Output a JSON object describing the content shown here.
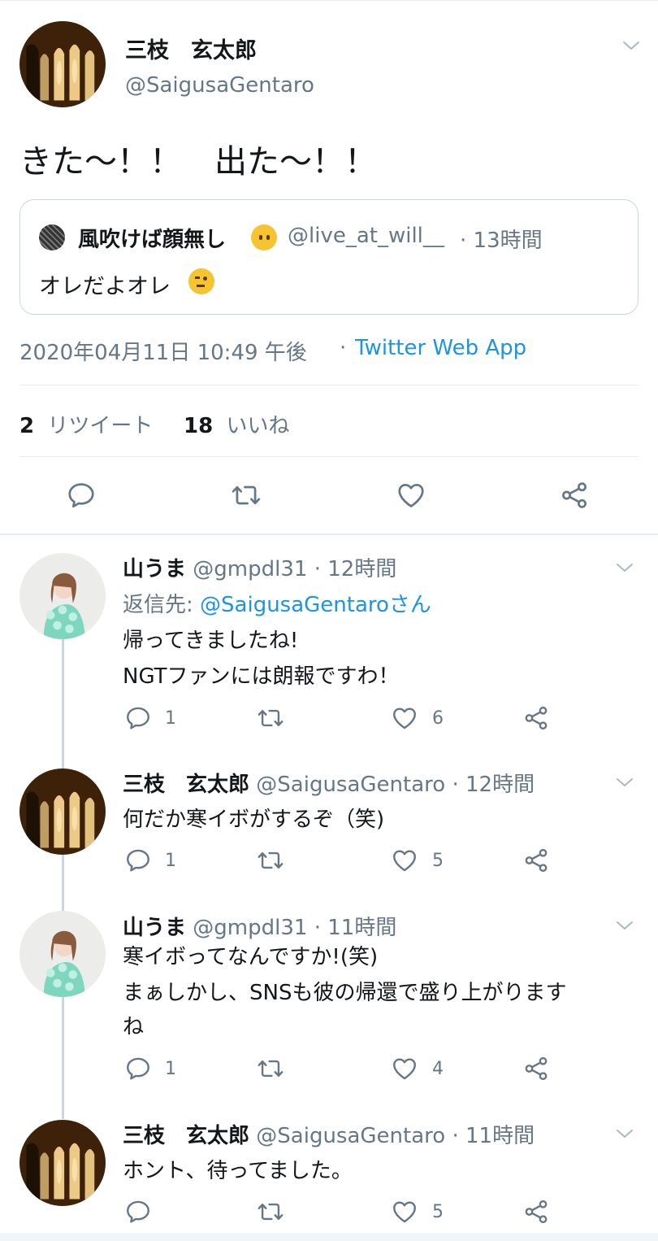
{
  "main_tweet": {
    "name": "三枝　玄太郎",
    "handle": "@SaigusaGentaro",
    "text": "きた〜！！　出た〜！！",
    "quote": {
      "name": "風吹けば顔無し",
      "handle": "@live_at_will__",
      "time": "· 13時間",
      "text": "オレだよオレ"
    },
    "timestamp": "2020年04月11日 10:49 午後",
    "sep": "·",
    "client": "Twitter Web App",
    "retweet_count": "2",
    "retweet_label": "リツイート",
    "like_count": "18",
    "like_label": "いいね"
  },
  "replies": [
    {
      "name": "山うま",
      "handle": "@gmpdl31",
      "time": "· 12時間",
      "reply_to_prefix": "返信先: ",
      "reply_to_handle": "@SaigusaGentaroさん",
      "text_lines": [
        "帰ってきましたね!",
        "NGTファンには朗報ですわ！"
      ],
      "replies": "1",
      "retweets": "",
      "likes": "6"
    },
    {
      "name": "三枝　玄太郎",
      "handle": "@SaigusaGentaro",
      "time": "· 12時間",
      "text_lines": [
        "何だか寒イボがするぞ（笑)"
      ],
      "replies": "1",
      "retweets": "",
      "likes": "5"
    },
    {
      "name": "山うま",
      "handle": "@gmpdl31",
      "time": "· 11時間",
      "text_lines": [
        "寒イボってなんですか!(笑)",
        "まぁしかし、SNSも彼の帰還で盛り上がります",
        "ね"
      ],
      "replies": "1",
      "retweets": "",
      "likes": "4"
    },
    {
      "name": "三枝　玄太郎",
      "handle": "@SaigusaGentaro",
      "time": "· 11時間",
      "text_lines": [
        "ホント、待ってました。"
      ],
      "replies": "",
      "retweets": "",
      "likes": "5"
    }
  ],
  "icons": {
    "reply": "reply-icon",
    "retweet": "retweet-icon",
    "like": "heart-icon",
    "share": "share-icon",
    "more": "chevron-down-icon"
  },
  "colors": {
    "link": "#1b95e0",
    "muted": "#657786",
    "text": "#14171a",
    "divider": "#e6ecf0"
  }
}
